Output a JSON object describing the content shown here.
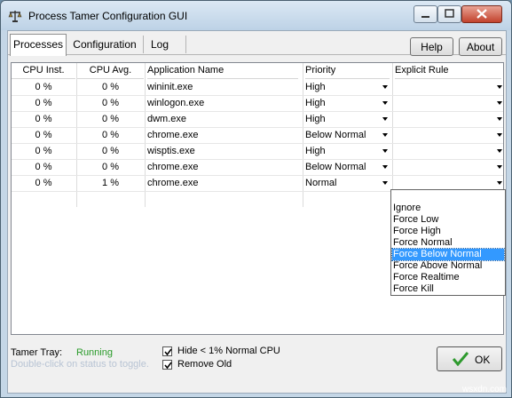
{
  "window": {
    "title": "Process Tamer Configuration GUI",
    "controls": [
      "minimize",
      "maximize",
      "close"
    ]
  },
  "tabs": [
    {
      "label": "Processes",
      "active": true
    },
    {
      "label": "Configuration",
      "active": false
    },
    {
      "label": "Log",
      "active": false
    }
  ],
  "header_buttons": {
    "help": "Help",
    "about": "About"
  },
  "table": {
    "columns": [
      "CPU Inst.",
      "CPU Avg.",
      "Application Name",
      "Priority",
      "Explicit Rule"
    ],
    "rows": [
      {
        "cpu_inst": "0 %",
        "cpu_avg": "0 %",
        "app": "wininit.exe",
        "priority": "High",
        "rule": ""
      },
      {
        "cpu_inst": "0 %",
        "cpu_avg": "0 %",
        "app": "winlogon.exe",
        "priority": "High",
        "rule": ""
      },
      {
        "cpu_inst": "0 %",
        "cpu_avg": "0 %",
        "app": "dwm.exe",
        "priority": "High",
        "rule": ""
      },
      {
        "cpu_inst": "0 %",
        "cpu_avg": "0 %",
        "app": "chrome.exe",
        "priority": "Below Normal",
        "rule": ""
      },
      {
        "cpu_inst": "0 %",
        "cpu_avg": "0 %",
        "app": "wisptis.exe",
        "priority": "High",
        "rule": ""
      },
      {
        "cpu_inst": "0 %",
        "cpu_avg": "0 %",
        "app": "chrome.exe",
        "priority": "Below Normal",
        "rule": ""
      },
      {
        "cpu_inst": "0 %",
        "cpu_avg": "1 %",
        "app": "chrome.exe",
        "priority": "Normal",
        "rule": ""
      }
    ]
  },
  "rule_dropdown": {
    "options": [
      "",
      "Ignore",
      "Force Low",
      "Force High",
      "Force Normal",
      "Force Below Normal",
      "Force Above Normal",
      "Force Realtime",
      "Force Kill"
    ],
    "highlighted": "Force Below Normal"
  },
  "footer": {
    "tray_label": "Tamer Tray:",
    "tray_status": "Running",
    "tray_status_color": "#2a9b2a",
    "hint": "Double-click on status to toggle.",
    "hide_label": "Hide < 1% Normal CPU",
    "hide_checked": true,
    "remove_label": "Remove Old",
    "remove_checked": true,
    "ok_label": "OK"
  },
  "watermark": "wsxdn.com"
}
